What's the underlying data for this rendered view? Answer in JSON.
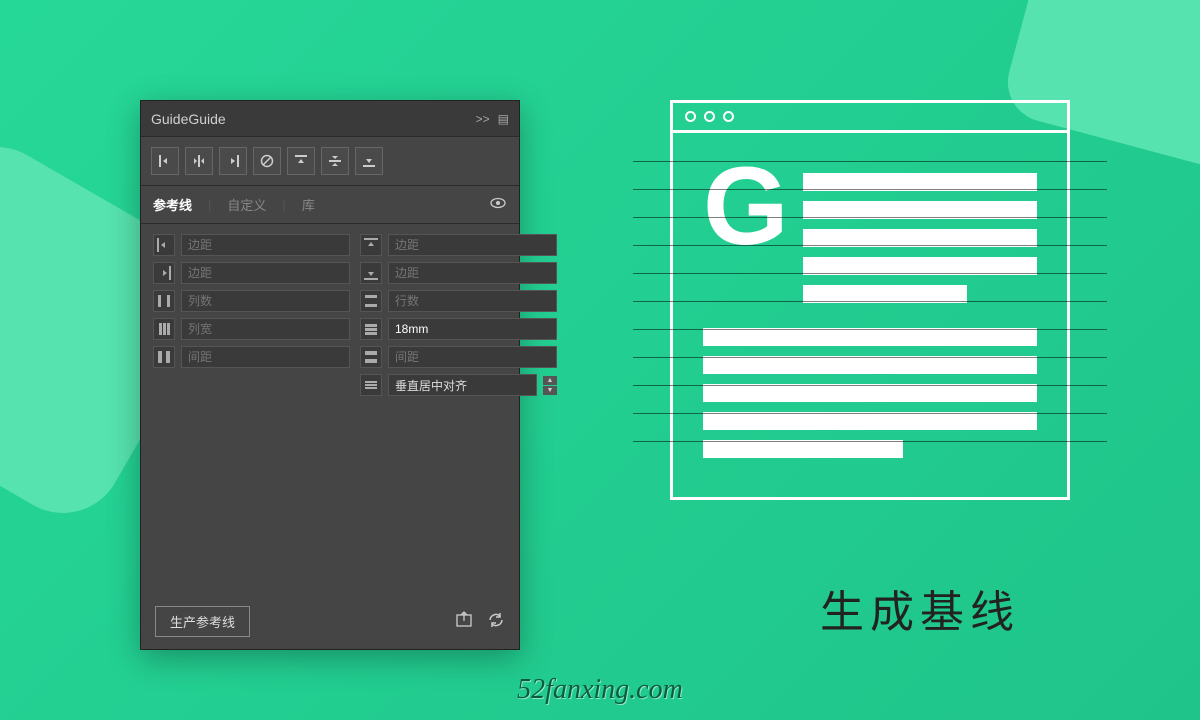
{
  "panel": {
    "title": "GuideGuide",
    "collapse": ">>",
    "tabs": {
      "guides": "参考线",
      "custom": "自定义",
      "library": "库"
    },
    "fields": {
      "left_margin": "边距",
      "right_margin": "边距",
      "columns": "列数",
      "col_width": "列宽",
      "gutter": "间距",
      "top_margin": "边距",
      "bottom_margin": "边距",
      "rows": "行数",
      "row_height_value": "18mm",
      "row_gutter": "间距",
      "align_value": "垂直居中对齐"
    },
    "generate_btn": "生产参考线"
  },
  "illustration": {
    "letter": "G"
  },
  "caption": "生成基线",
  "watermark": "52fanxing.com"
}
